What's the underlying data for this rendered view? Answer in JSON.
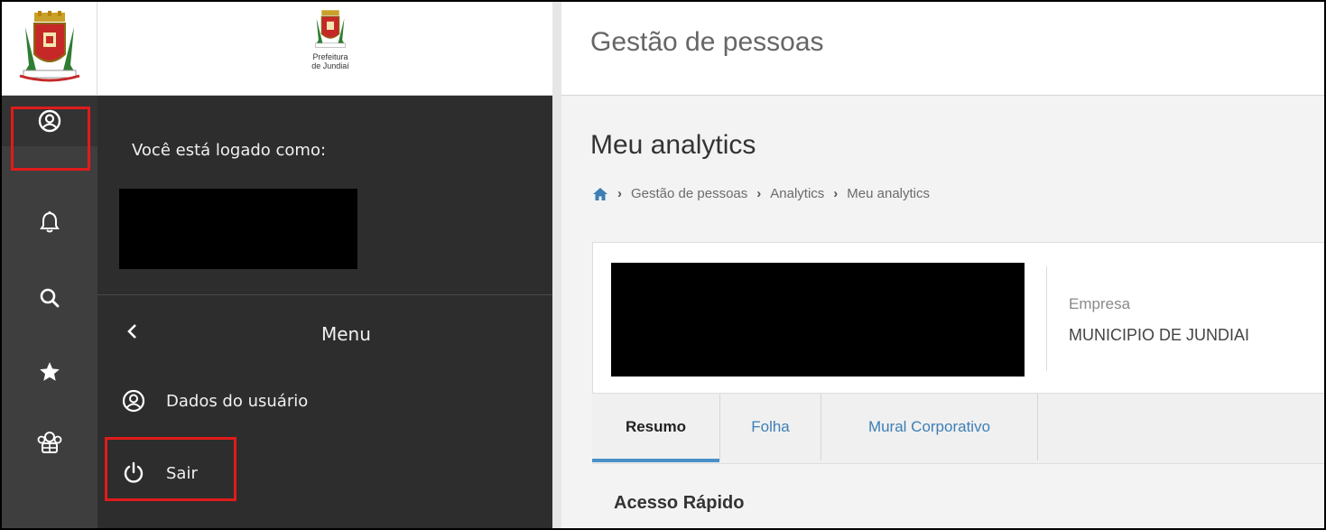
{
  "logo": {
    "line1": "Prefeitura",
    "line2": "de Jundiaí"
  },
  "header": {
    "title": "Gestão de pessoas"
  },
  "rail": {
    "icons": [
      "user-circle-icon",
      "bell-icon",
      "search-icon",
      "star-icon",
      "team-icon"
    ]
  },
  "panel": {
    "logged_label": "Você está logado como:",
    "menu_title": "Menu",
    "items": [
      {
        "label": "Dados do usuário",
        "icon": "user-circle-icon"
      },
      {
        "label": "Sair",
        "icon": "power-icon"
      }
    ]
  },
  "main": {
    "page_title": "Meu analytics",
    "breadcrumb": [
      "Gestão de pessoas",
      "Analytics",
      "Meu analytics"
    ],
    "company_label": "Empresa",
    "company_name": "MUNICIPIO DE JUNDIAI",
    "tabs": [
      {
        "label": "Resumo",
        "active": true
      },
      {
        "label": "Folha",
        "active": false
      },
      {
        "label": "Mural Corporativo",
        "active": false
      }
    ],
    "section_title": "Acesso Rápido"
  },
  "colors": {
    "highlight": "#e01b1b",
    "rail_bg": "#3e3e3e",
    "panel_bg": "#2d2d2d",
    "tab_accent": "#4a90c8",
    "link": "#3d7fb5"
  }
}
